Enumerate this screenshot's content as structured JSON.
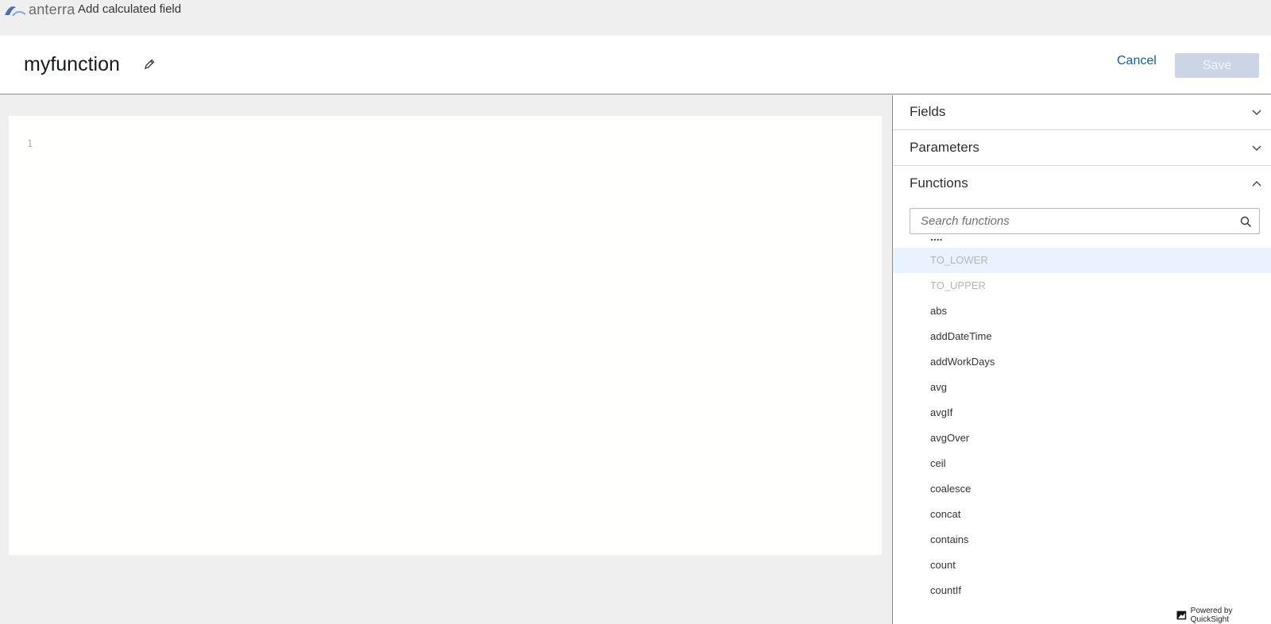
{
  "topbar": {
    "logo_text": "anterra",
    "title": "Add calculated field"
  },
  "header": {
    "field_name": "myfunction",
    "cancel_label": "Cancel",
    "save_label": "Save"
  },
  "editor": {
    "line_number": "1"
  },
  "panel": {
    "sections": [
      {
        "title": "Fields",
        "expanded": false
      },
      {
        "title": "Parameters",
        "expanded": false
      },
      {
        "title": "Functions",
        "expanded": true
      }
    ],
    "search_placeholder": "Search functions",
    "truncated_marker": "....",
    "functions": [
      "TO_LOWER",
      "TO_UPPER",
      "abs",
      "addDateTime",
      "addWorkDays",
      "avg",
      "avgIf",
      "avgOver",
      "ceil",
      "coalesce",
      "concat",
      "contains",
      "count",
      "countIf"
    ],
    "highlighted_function": "TO_LOWER"
  },
  "footer": {
    "powered_by": "Powered by QuickSight"
  },
  "colors": {
    "accent_link": "#0b5fb3",
    "save_disabled": "#ccd5e6",
    "row_highlight": "#eaf3fd"
  },
  "icons": [
    "logo-icon",
    "pencil-icon",
    "chevron-down-icon",
    "chevron-up-icon",
    "search-icon",
    "quicksight-icon"
  ]
}
